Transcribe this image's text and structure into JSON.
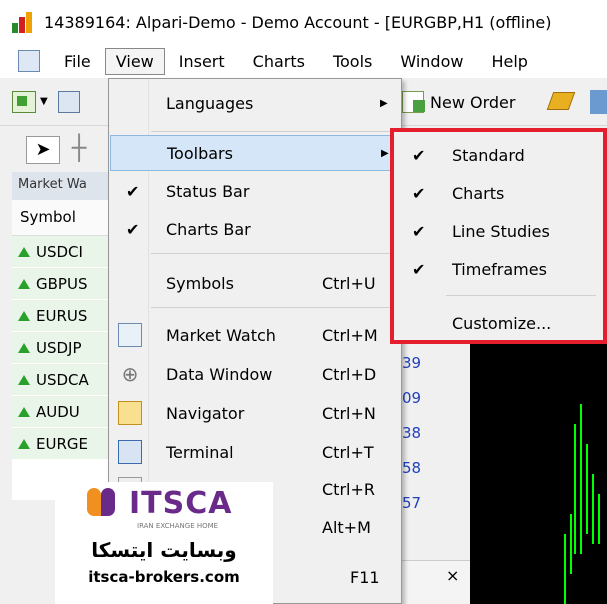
{
  "window": {
    "title": "14389164: Alpari-Demo - Demo Account - [EURGBP,H1 (offline)"
  },
  "menubar": {
    "items": [
      {
        "label": "File"
      },
      {
        "label": "View"
      },
      {
        "label": "Insert"
      },
      {
        "label": "Charts"
      },
      {
        "label": "Tools"
      },
      {
        "label": "Window"
      },
      {
        "label": "Help"
      }
    ]
  },
  "toolbar": {
    "new_order_label": "New Order"
  },
  "market_watch": {
    "header": "Market Wa",
    "column": "Symbol",
    "rows": [
      {
        "symbol": "USDCI"
      },
      {
        "symbol": "GBPUS"
      },
      {
        "symbol": "EURUS"
      },
      {
        "symbol": "USDJP"
      },
      {
        "symbol": "USDCA"
      },
      {
        "symbol": "AUDU"
      },
      {
        "symbol": "EURGE"
      }
    ]
  },
  "view_menu": {
    "items": [
      {
        "label": "Languages",
        "submenu": true
      },
      {
        "label": "Toolbars",
        "submenu": true,
        "highlighted": true
      },
      {
        "label": "Status Bar",
        "checked": true
      },
      {
        "label": "Charts Bar",
        "checked": true
      },
      {
        "label": "Symbols",
        "shortcut": "Ctrl+U"
      },
      {
        "label": "Market Watch",
        "shortcut": "Ctrl+M",
        "icon": "market-watch-icon"
      },
      {
        "label": "Data Window",
        "shortcut": "Ctrl+D",
        "icon": "crosshair-icon"
      },
      {
        "label": "Navigator",
        "shortcut": "Ctrl+N",
        "icon": "navigator-icon"
      },
      {
        "label": "Terminal",
        "shortcut": "Ctrl+T",
        "icon": "terminal-icon"
      },
      {
        "label": "",
        "shortcut": "Ctrl+R"
      },
      {
        "label": "",
        "shortcut": "Alt+M"
      },
      {
        "label": "",
        "shortcut": "F11"
      }
    ]
  },
  "toolbars_submenu": {
    "items": [
      {
        "label": "Standard",
        "checked": true
      },
      {
        "label": "Charts",
        "checked": true
      },
      {
        "label": "Line Studies",
        "checked": true
      },
      {
        "label": "Timeframes",
        "checked": true
      },
      {
        "label": "Customize..."
      }
    ],
    "highlight_color": "#e41e2c"
  },
  "overlay_logo": {
    "brand": "ITSCA",
    "tagline": "IRAN EXCHANGE HOME",
    "persian_text": "وبسایت ایتسکا",
    "url": "itsca-brokers.com"
  },
  "partial_values": [
    "39",
    "09",
    "38",
    "58",
    "57"
  ],
  "colors": {
    "menu_highlight": "#d4e6f7",
    "up_arrow": "#2aa02a",
    "chart_bg": "#000000",
    "chart_line": "#00ff00"
  }
}
